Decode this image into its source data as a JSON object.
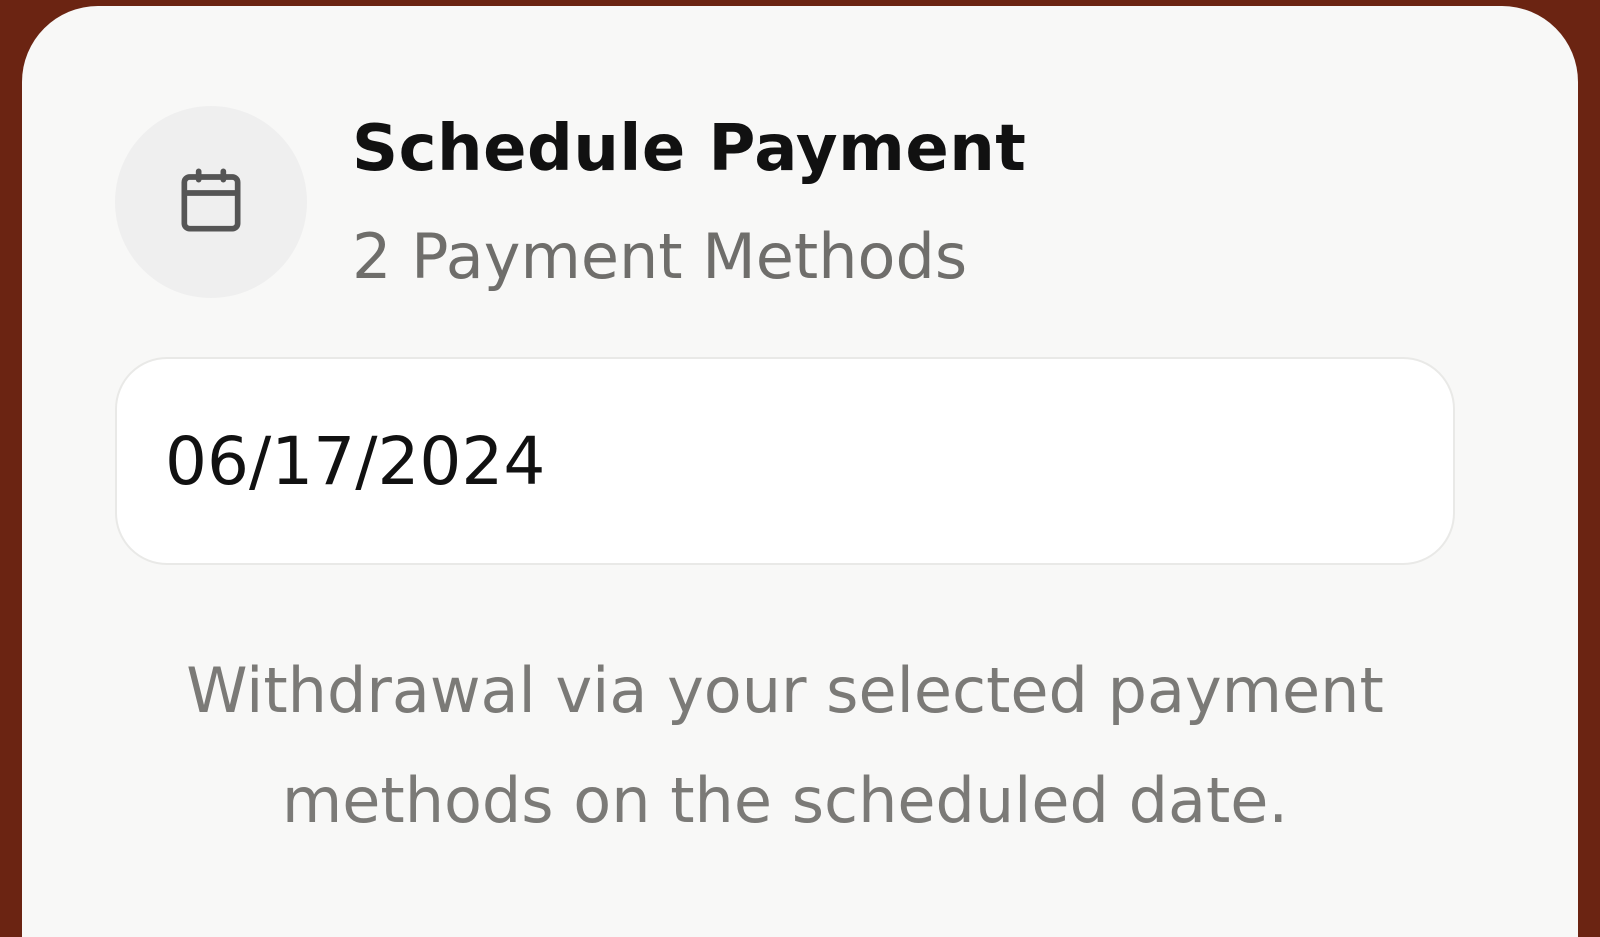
{
  "schedule": {
    "title": "Schedule Payment",
    "subtitle": "2 Payment Methods",
    "date_value": "06/17/2024",
    "note": "Withdrawal via your selected payment methods on the scheduled date.",
    "icon": "calendar-icon"
  },
  "colors": {
    "background": "#6b2412",
    "card": "#f8f8f7",
    "title": "#111111",
    "muted_text": "#6f6e6b"
  }
}
